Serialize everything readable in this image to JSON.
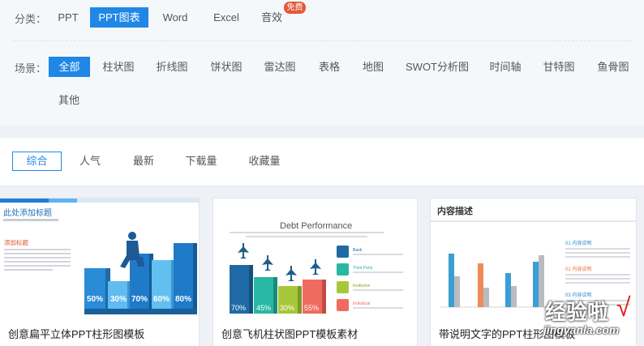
{
  "filters": {
    "category": {
      "label": "分类：",
      "items": [
        "PPT",
        "PPT图表",
        "Word",
        "Excel",
        "音效"
      ],
      "active": "PPT图表",
      "badge": "免费"
    },
    "scene": {
      "label": "场景：",
      "items": [
        "全部",
        "柱状图",
        "折线图",
        "饼状图",
        "雷达图",
        "表格",
        "地图",
        "SWOT分析图",
        "时间轴",
        "甘特图",
        "鱼骨图",
        "其他"
      ],
      "active": "全部"
    }
  },
  "sort": {
    "items": [
      "综合",
      "人气",
      "最新",
      "下载量",
      "收藏量"
    ],
    "active": "综合"
  },
  "cards": [
    {
      "title": "创意扁平立体PPT柱形图模板",
      "thumb": {
        "heading": "此处添加标题",
        "subheading": "添加标题",
        "values": [
          "50%",
          "30%",
          "70%",
          "60%",
          "80%"
        ]
      }
    },
    {
      "title": "创意飞机柱状图PPT模板素材",
      "thumb": {
        "heading": "Debt Performance",
        "values": [
          "70%",
          "45%",
          "30%",
          "55%"
        ],
        "items": [
          "Bank",
          "Third Party",
          "Institution",
          "Individual"
        ]
      }
    },
    {
      "title": "带说明文字的PPT柱形图模板",
      "thumb": {
        "heading": "内容描述",
        "items": [
          "01 内容说明",
          "02 内容说明",
          "03 内容说明"
        ]
      }
    }
  ],
  "watermark": {
    "title": "经验啦",
    "subtitle": "jingyanla.com",
    "check": "√"
  },
  "colors": {
    "accent": "#1f88e6",
    "badge": "#e45a39"
  }
}
